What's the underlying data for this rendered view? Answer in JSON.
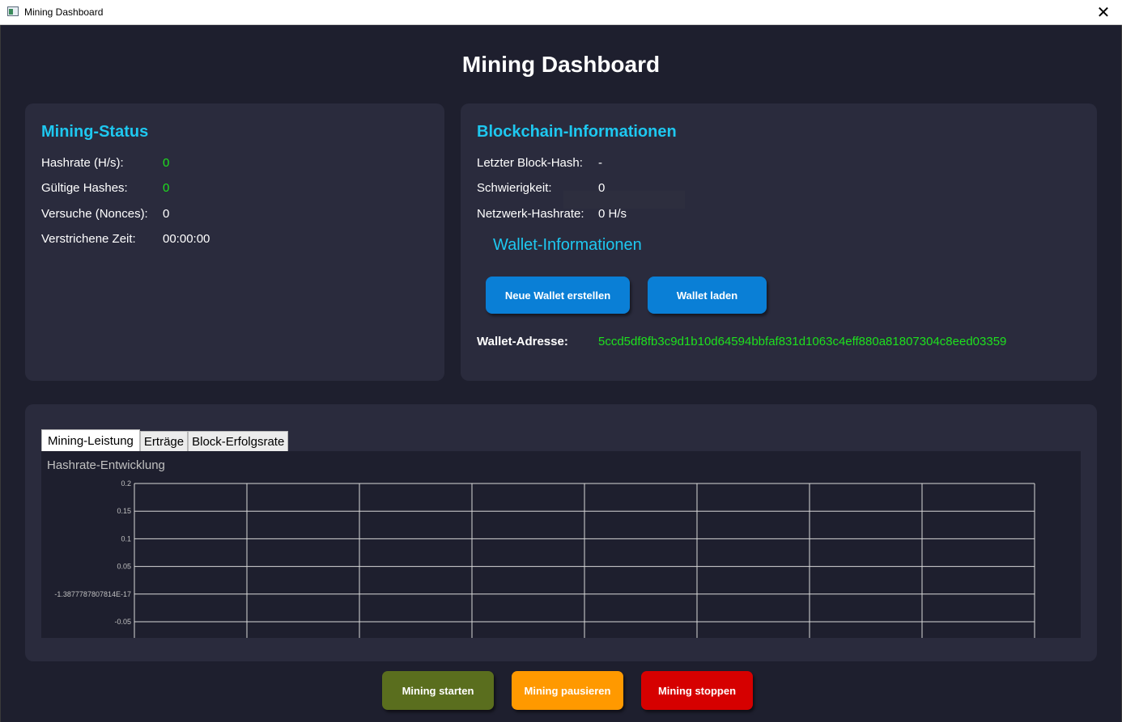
{
  "window": {
    "title": "Mining Dashboard",
    "close_glyph": "✕"
  },
  "page_title": "Mining Dashboard",
  "mining_status": {
    "heading": "Mining-Status",
    "rows": [
      {
        "label": "Hashrate (H/s):",
        "value": "0"
      },
      {
        "label": "Gültige Hashes:",
        "value": "0"
      },
      {
        "label": "Versuche (Nonces):",
        "value": "0"
      },
      {
        "label": "Verstrichene Zeit:",
        "value": "00:00:00"
      }
    ]
  },
  "blockchain": {
    "heading": "Blockchain-Informationen",
    "rows": [
      {
        "label": "Letzter Block-Hash:",
        "value": "-"
      },
      {
        "label": "Schwierigkeit:",
        "value": "0"
      },
      {
        "label": "Netzwerk-Hashrate:",
        "value": "0 H/s"
      }
    ]
  },
  "wallet": {
    "heading": "Wallet-Informationen",
    "create_button": "Neue Wallet erstellen",
    "load_button": "Wallet laden",
    "address_label": "Wallet-Adresse:",
    "address_value": "5ccd5df8fb3c9d1b10d64594bbfaf831d1063c4eff880a81807304c8eed03359"
  },
  "tabs": [
    {
      "label": "Mining-Leistung",
      "active": true
    },
    {
      "label": "Erträge",
      "active": false
    },
    {
      "label": "Block-Erfolgsrate",
      "active": false
    }
  ],
  "chart_data": {
    "type": "line",
    "title": "Hashrate-Entwicklung",
    "xlabel": "",
    "ylabel": "",
    "series": [],
    "yticks": [
      "0.2",
      "0.15",
      "0.1",
      "0.05",
      "-1.3877787807814E-17",
      "-0.05"
    ],
    "ytick_values": [
      0.2,
      0.15,
      0.1,
      0.05,
      0,
      -0.05
    ],
    "x_grid_lines": 8,
    "grid": true,
    "colors": {
      "grid": "#d8d8d8",
      "tick_label": "#c0c0c0"
    }
  },
  "controls": {
    "start": "Mining starten",
    "pause": "Mining pausieren",
    "stop": "Mining stoppen"
  },
  "colors": {
    "background": "#1e1f2e",
    "panel": "#2a2b3d",
    "heading": "#1ec8f0",
    "value_green": "#1ee01e",
    "button_blue": "#0a7fd6",
    "start": "#5a6e1e",
    "pause": "#ff9900",
    "stop": "#d60000"
  }
}
